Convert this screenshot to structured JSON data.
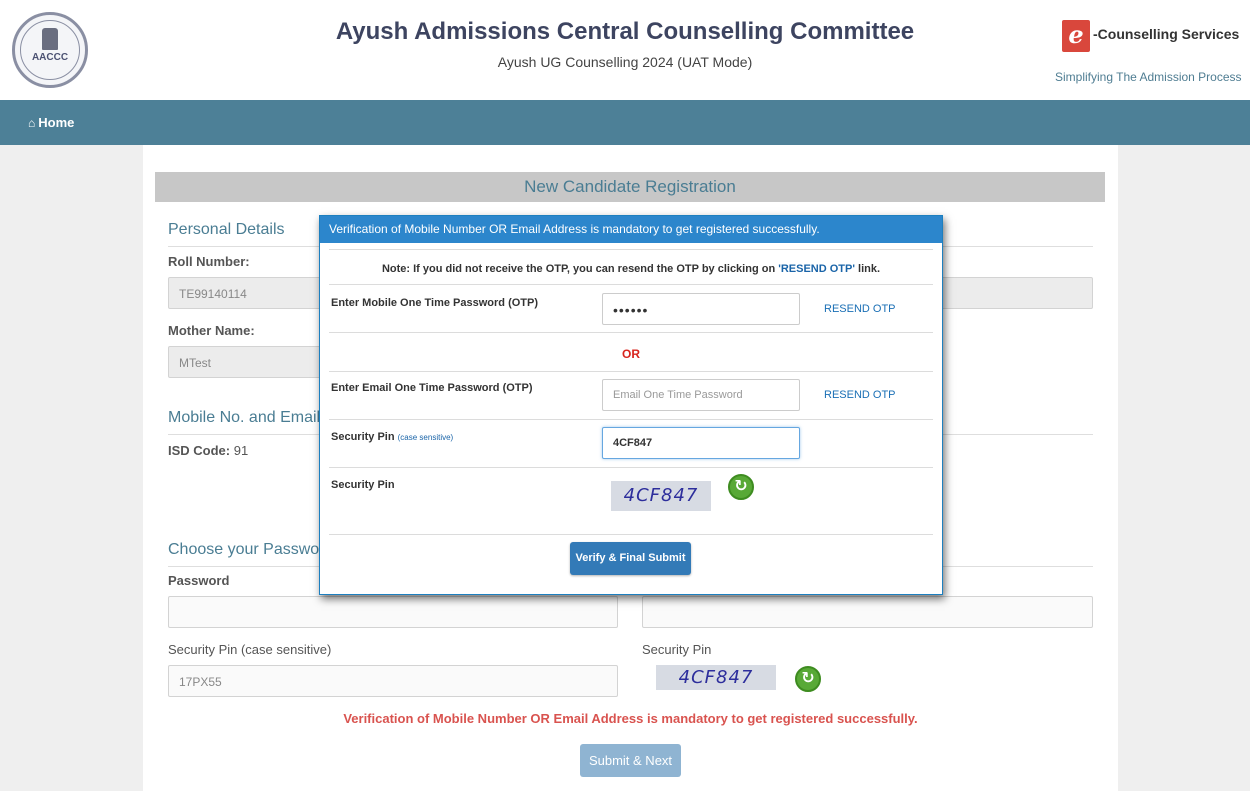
{
  "header": {
    "logo_text": "AACCC",
    "title": "Ayush Admissions Central Counselling Committee",
    "subtitle": "Ayush UG Counselling 2024 (UAT Mode)",
    "brand_mark": "e",
    "brand_name": "-Counselling Services",
    "brand_tagline": "Simplifying The Admission Process"
  },
  "nav": {
    "home_icon": "home-icon",
    "home_label": "Home"
  },
  "form": {
    "title": "New Candidate Registration",
    "personal_details": "Personal Details",
    "roll_number_label": "Roll Number:",
    "roll_number_value": "TE99140114",
    "mother_name_label": "Mother Name:",
    "mother_name_value": "MTest",
    "mobile_section": "Mobile No. and Email",
    "isd_label": "ISD Code:",
    "isd_value": " 91",
    "password_section": "Choose your Password",
    "password_label": "Password",
    "security_pin_label": "Security Pin (case sensitive)",
    "security_pin_value": "17PX55",
    "security_pin_label2": "Security Pin",
    "captcha_text": "4CF847",
    "warning": "Verification of Mobile Number OR Email Address is mandatory to get registered successfully.",
    "submit_label": "Submit & Next"
  },
  "modal": {
    "header": "Verification of Mobile Number OR Email Address is mandatory to get registered successfully.",
    "note_prefix": "Note: If you did not receive the OTP,    you can resend the OTP by clicking on ",
    "note_link": "'RESEND OTP'",
    "note_suffix": " link.",
    "mobile_otp_label": "Enter Mobile One Time Password (OTP)",
    "mobile_otp_value": "••••••",
    "resend_label": "RESEND OTP",
    "or_label": "OR",
    "email_otp_label": "Enter Email One Time Password (OTP)",
    "email_otp_placeholder": "Email One Time Password",
    "security_pin_label": "Security Pin ",
    "security_pin_hint": "(case sensitive)",
    "security_pin_value": "4CF847",
    "captcha_label": "Security Pin",
    "captcha_text": "4CF847",
    "verify_label": "Verify & Final Submit"
  }
}
